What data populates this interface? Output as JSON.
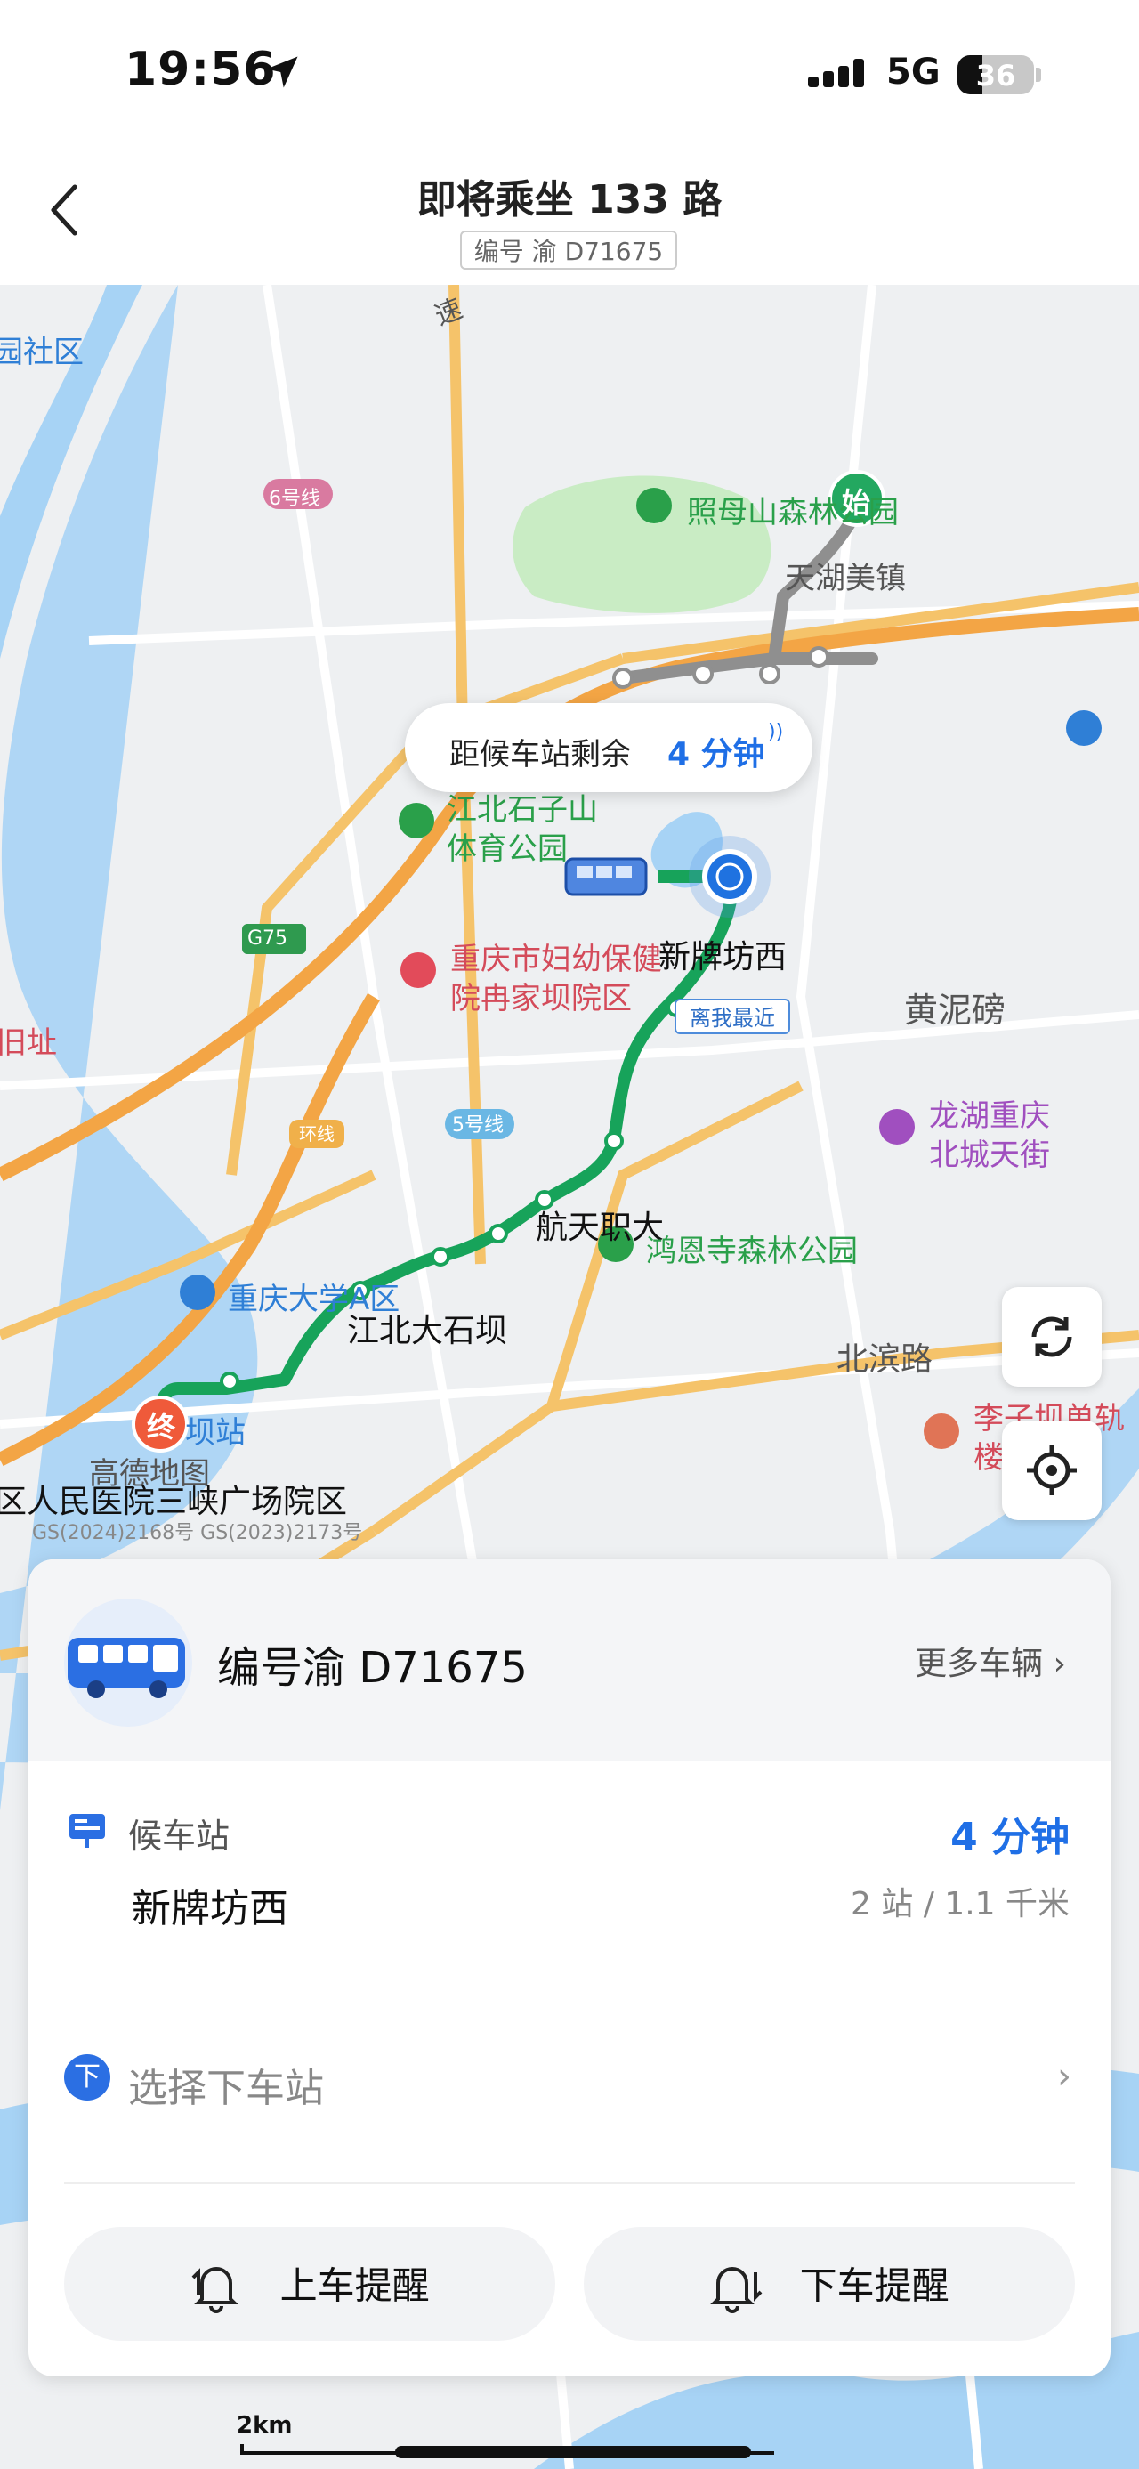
{
  "status_bar": {
    "time": "19:56",
    "network": "5G",
    "battery": "36"
  },
  "header": {
    "title": "即将乘坐 133 路",
    "plate_tag": "编号 渝 D71675"
  },
  "map": {
    "bubble": {
      "prefix": "距候车站剩余",
      "eta": "4 分钟"
    },
    "nearest_tag": "离我最近",
    "start_badge": "始",
    "end_badge": "终",
    "logo": "高德地图",
    "labels": {
      "park1": "照母山森林公园",
      "town1": "天湖美镇",
      "park2_l1": "江北石子山",
      "park2_l2": "体育公园",
      "hosp1_l1": "重庆市妇幼保健",
      "hosp1_l2": "院冉家坝院区",
      "stop_cur": "新牌坊西",
      "area1": "黄泥磅",
      "mall_l1": "龙湖重庆",
      "mall_l2": "北城天街",
      "stop_a": "航天职大",
      "park3": "鸿恩寺森林公园",
      "univ": "重庆大学A区",
      "stop_b": "江北大石坝",
      "road1": "北滨路",
      "station_l1": "李子坝单轨",
      "station_l2": "楼",
      "hosp2": "区人民医院三峡广场院区",
      "stop_c": "坝站",
      "area2": "园社区",
      "area3": "旧址",
      "highway": "速",
      "metro6": "6号线",
      "metro5": "5号线",
      "ring": "环线",
      "g75": "G75",
      "copyright": "GS(2024)2168号 GS(2023)2173号"
    },
    "scale": "2km"
  },
  "bus_card": {
    "plate": "编号渝 D71675",
    "more_vehicles": "更多车辆",
    "stop_type": "候车站",
    "stop_name": "新牌坊西",
    "eta": "4 分钟",
    "distance": "2 站 / 1.1 千米",
    "alight_badge": "下",
    "choose_alight": "选择下车站",
    "board_reminder": "上车提醒",
    "alight_reminder": "下车提醒"
  }
}
